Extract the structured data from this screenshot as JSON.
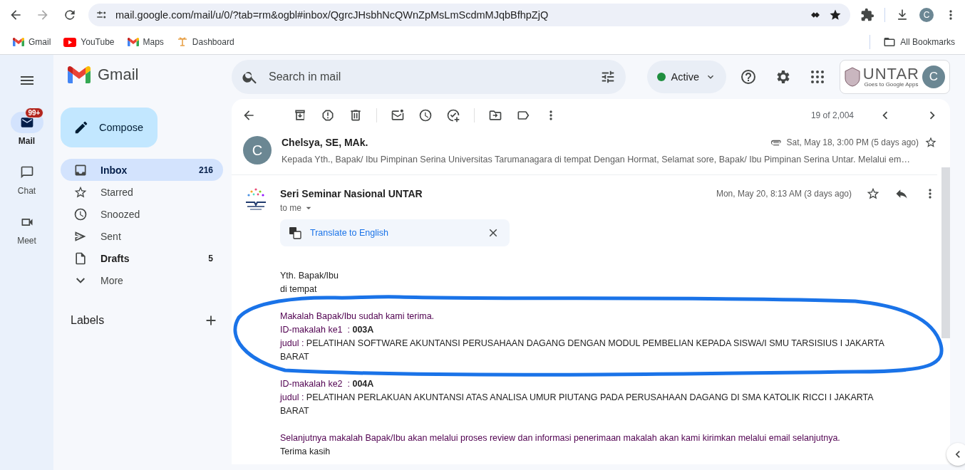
{
  "browser": {
    "url": "mail.google.com/mail/u/0/?tab=rm&ogbl#inbox/QgrcJHsbhNcQWnZpMsLmScdmMJqbBfhpZjQ",
    "profile_initial": "C",
    "bookmarks": [
      {
        "label": "Gmail",
        "kind": "gmail"
      },
      {
        "label": "YouTube",
        "kind": "youtube"
      },
      {
        "label": "Maps",
        "kind": "gmail"
      },
      {
        "label": "Dashboard",
        "kind": "dashboard"
      }
    ],
    "all_bookmarks": "All Bookmarks"
  },
  "gmail": {
    "app_name": "Gmail",
    "search_placeholder": "Search in mail",
    "status": "Active",
    "org_logo": "UNTAR",
    "org_tagline": "Goes to Google Apps",
    "account_initial": "C",
    "rail": [
      {
        "label": "Mail",
        "selected": true,
        "badge": "99+",
        "kind": "mail"
      },
      {
        "label": "Chat",
        "selected": false,
        "kind": "chat"
      },
      {
        "label": "Meet",
        "selected": false,
        "kind": "meet"
      }
    ],
    "compose": "Compose",
    "folders": [
      {
        "label": "Inbox",
        "count": "216",
        "selected": true,
        "unread": true,
        "kind": "inbox"
      },
      {
        "label": "Starred",
        "selected": false,
        "unread": false,
        "kind": "star"
      },
      {
        "label": "Snoozed",
        "selected": false,
        "unread": false,
        "kind": "clock"
      },
      {
        "label": "Sent",
        "selected": false,
        "unread": false,
        "kind": "sent"
      },
      {
        "label": "Drafts",
        "count": "5",
        "selected": false,
        "unread": true,
        "kind": "draft"
      },
      {
        "label": "More",
        "selected": false,
        "unread": false,
        "kind": "more"
      }
    ],
    "labels_heading": "Labels"
  },
  "toolbar": {
    "counter": "19 of 2,004"
  },
  "messages": [
    {
      "kind": "collapsed",
      "avatar_initial": "C",
      "sender": "Chelsya, SE, MAk.",
      "has_attachment": true,
      "date": "Sat, May 18, 3:00 PM (5 days ago)",
      "snippet": "Kepada Yth., Bapak/ Ibu Pimpinan Serina Universitas Tarumanagara di tempat Dengan Hormat, Selamat sore, Bapak/ Ibu Pimpinan Serina Untar. Melalui em…"
    },
    {
      "kind": "expanded",
      "sender": "Seri Seminar Nasional UNTAR",
      "date": "Mon, May 20, 8:13 AM (3 days ago)",
      "to": "to me",
      "translate": "Translate to English",
      "body": [
        {
          "kind": "line",
          "text": "Yth. Bapak/Ibu"
        },
        {
          "kind": "line",
          "text": "di tempat"
        },
        {
          "kind": "spacer"
        },
        {
          "kind": "accent",
          "text": "Makalah Bapak/Ibu sudah kami terima."
        },
        {
          "kind": "paper",
          "id_label": "ID-makalah ke1  :",
          "id_value": "003A",
          "title_label": "judul :",
          "title": "PELATIHAN SOFTWARE AKUNTANSI PERUSAHAAN DAGANG DENGAN MODUL PEMBELIAN KEPADA SISWA/I SMU TARSISIUS I JAKARTA BARAT"
        },
        {
          "kind": "spacer"
        },
        {
          "kind": "paper",
          "id_label": "ID-makalah ke2  :",
          "id_value": "004A",
          "title_label": "judul :",
          "title": "PELATIHAN PERLAKUAN AKUNTANSI ATAS ANALISA UMUR PIUTANG PADA PERUSAHAAN DAGANG DI SMA KATOLIK RICCI I JAKARTA BARAT"
        },
        {
          "kind": "spacer"
        },
        {
          "kind": "accent",
          "text": "Selanjutnya makalah Bapak/Ibu akan melalui proses review dan informasi penerimaan makalah akan kami kirimkan melalui email selanjutnya."
        },
        {
          "kind": "line",
          "text": "Terima kasih"
        }
      ]
    }
  ]
}
